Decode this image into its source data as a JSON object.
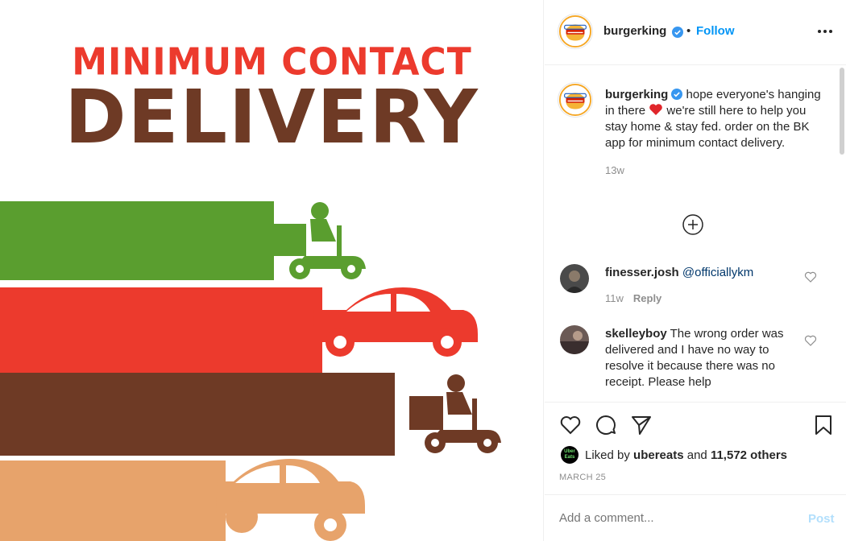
{
  "post_image": {
    "headline_top": "MINIMUM CONTACT",
    "headline_main": "DELIVERY",
    "colors": {
      "green": "#5a9e2f",
      "red": "#ec3a2d",
      "brown": "#6e3a25",
      "tan": "#e7a36b"
    }
  },
  "header": {
    "username": "burgerking",
    "separator": "•",
    "follow_label": "Follow",
    "more_icon": "more-options-icon"
  },
  "caption": {
    "username": "burgerking",
    "text_before_emoji": "hope everyone's hanging in there",
    "text_after_emoji": "we're still here to help you stay home & stay fed. order on the BK app for minimum contact delivery.",
    "time": "13w"
  },
  "comments": [
    {
      "username": "finesser.josh",
      "text": "@officiallykm",
      "time": "11w",
      "reply_label": "Reply"
    },
    {
      "username": "skelleyboy",
      "text": "The wrong order was delivered and I have no way to resolve it because there was no receipt. Please help"
    }
  ],
  "actions": {
    "liked_by_prefix": "Liked by",
    "liked_by_user": "ubereats",
    "liked_by_and": "and",
    "liked_by_count": "11,572 others",
    "date": "MARCH 25",
    "ubereats_logo_text": "Uber Eats"
  },
  "add_comment": {
    "placeholder": "Add a comment...",
    "post_label": "Post"
  }
}
